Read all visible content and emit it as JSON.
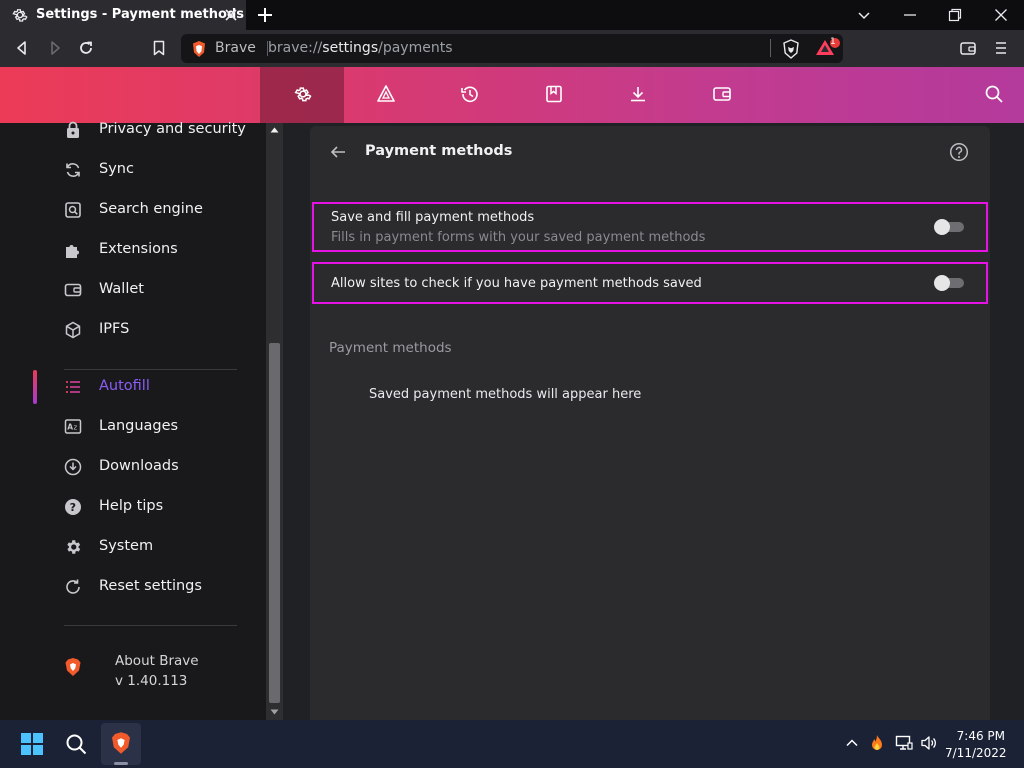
{
  "window": {
    "tab_title": "Settings - Payment methods"
  },
  "omnibox": {
    "brand": "Brave",
    "url_prefix": "brave://",
    "url_host": "settings",
    "url_path": "/payments",
    "alert_count": "1"
  },
  "sidebar": {
    "items": [
      {
        "label": "Privacy and security",
        "icon": "lock-icon"
      },
      {
        "label": "Sync",
        "icon": "sync-icon"
      },
      {
        "label": "Search engine",
        "icon": "search-engine-icon"
      },
      {
        "label": "Extensions",
        "icon": "puzzle-icon"
      },
      {
        "label": "Wallet",
        "icon": "wallet-icon"
      },
      {
        "label": "IPFS",
        "icon": "cube-icon"
      },
      {
        "label": "Autofill",
        "icon": "list-icon",
        "active": true
      },
      {
        "label": "Languages",
        "icon": "language-icon"
      },
      {
        "label": "Downloads",
        "icon": "download-icon"
      },
      {
        "label": "Help tips",
        "icon": "help-icon"
      },
      {
        "label": "System",
        "icon": "gear-icon"
      },
      {
        "label": "Reset settings",
        "icon": "reset-icon"
      }
    ],
    "about": {
      "label": "About Brave",
      "version": "v 1.40.113"
    }
  },
  "main": {
    "title": "Payment methods",
    "rows": [
      {
        "title": "Save and fill payment methods",
        "subtitle": "Fills in payment forms with your saved payment methods",
        "enabled": false
      },
      {
        "title": "Allow sites to check if you have payment methods saved",
        "enabled": false
      }
    ],
    "section_label": "Payment methods",
    "empty_text": "Saved payment methods will appear here"
  },
  "taskbar": {
    "time": "7:46 PM",
    "date": "7/11/2022"
  },
  "colors": {
    "header_start": "#ec3b57",
    "header_end": "#b43a9c",
    "highlight_border": "#e514e5",
    "active_nav": "#8b5cf6"
  }
}
